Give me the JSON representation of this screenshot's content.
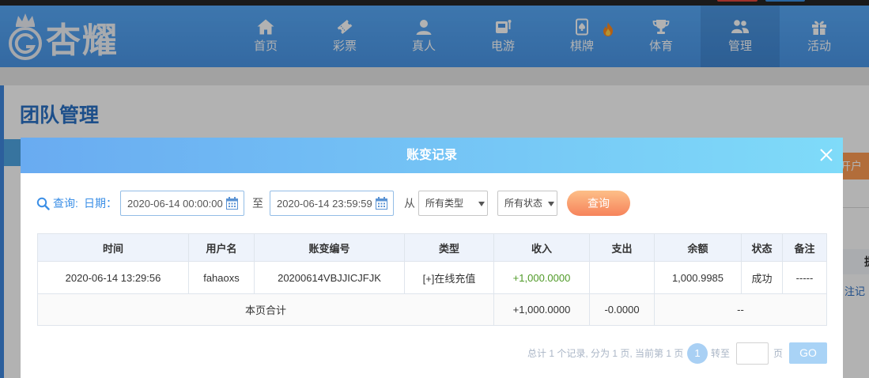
{
  "header": {
    "logo_text": "杏耀",
    "nav": [
      {
        "label": "首页",
        "icon": "home-icon"
      },
      {
        "label": "彩票",
        "icon": "lottery-icon"
      },
      {
        "label": "真人",
        "icon": "live-casino-icon"
      },
      {
        "label": "电游",
        "icon": "slot-machine-icon"
      },
      {
        "label": "棋牌",
        "icon": "card-game-icon",
        "badge_icon": "hot-flame-icon"
      },
      {
        "label": "体育",
        "icon": "trophy-icon"
      },
      {
        "label": "管理",
        "icon": "team-icon",
        "active": true
      },
      {
        "label": "活动",
        "icon": "gift-icon"
      }
    ]
  },
  "page": {
    "title": "团队管理",
    "open_account_button": "开户",
    "table_header_fragment": "提",
    "link_fragment": "注记"
  },
  "modal": {
    "title": "账变记录",
    "close_icon": "close-icon",
    "search": {
      "query_label": "查询:",
      "date_label": "日期：",
      "start_datetime": "2020-06-14 00:00:00",
      "range_separator": "至",
      "end_datetime": "2020-06-14 23:59:59",
      "from_label": "从",
      "type_filter": "所有类型",
      "status_filter": "所有状态",
      "submit_label": "查询"
    },
    "table": {
      "columns": [
        "时间",
        "用户名",
        "账变编号",
        "类型",
        "收入",
        "支出",
        "余额",
        "状态",
        "备注"
      ],
      "rows": [
        {
          "time": "2020-06-14 13:29:56",
          "username": "fahaoxs",
          "serial_no": "20200614VBJJICJFJK",
          "type": "[+]在线充值",
          "income": "+1,000.0000",
          "expense": "",
          "balance": "1,000.9985",
          "status": "成功",
          "remark": "-----"
        }
      ],
      "summary": {
        "label": "本页合计",
        "income": "+1,000.0000",
        "expense": "-0.0000",
        "balance": "--"
      }
    },
    "pagination": {
      "summary": "总计 1 个记录, 分为 1 页, 当前第 1 页",
      "current_page": "1",
      "goto_label": "转至",
      "page_unit": "页",
      "go_label": "GO"
    }
  },
  "colors": {
    "header_blue": "#4b97e8",
    "modal_header_start": "#69abf1",
    "modal_header_end": "#7fdbf9",
    "primary_blue": "#3a8ee6",
    "income_green": "#4f9a27",
    "query_button_orange": "#f6835b",
    "open_account_orange": "#ff9d54",
    "table_header_bg": "#eef3fb"
  }
}
